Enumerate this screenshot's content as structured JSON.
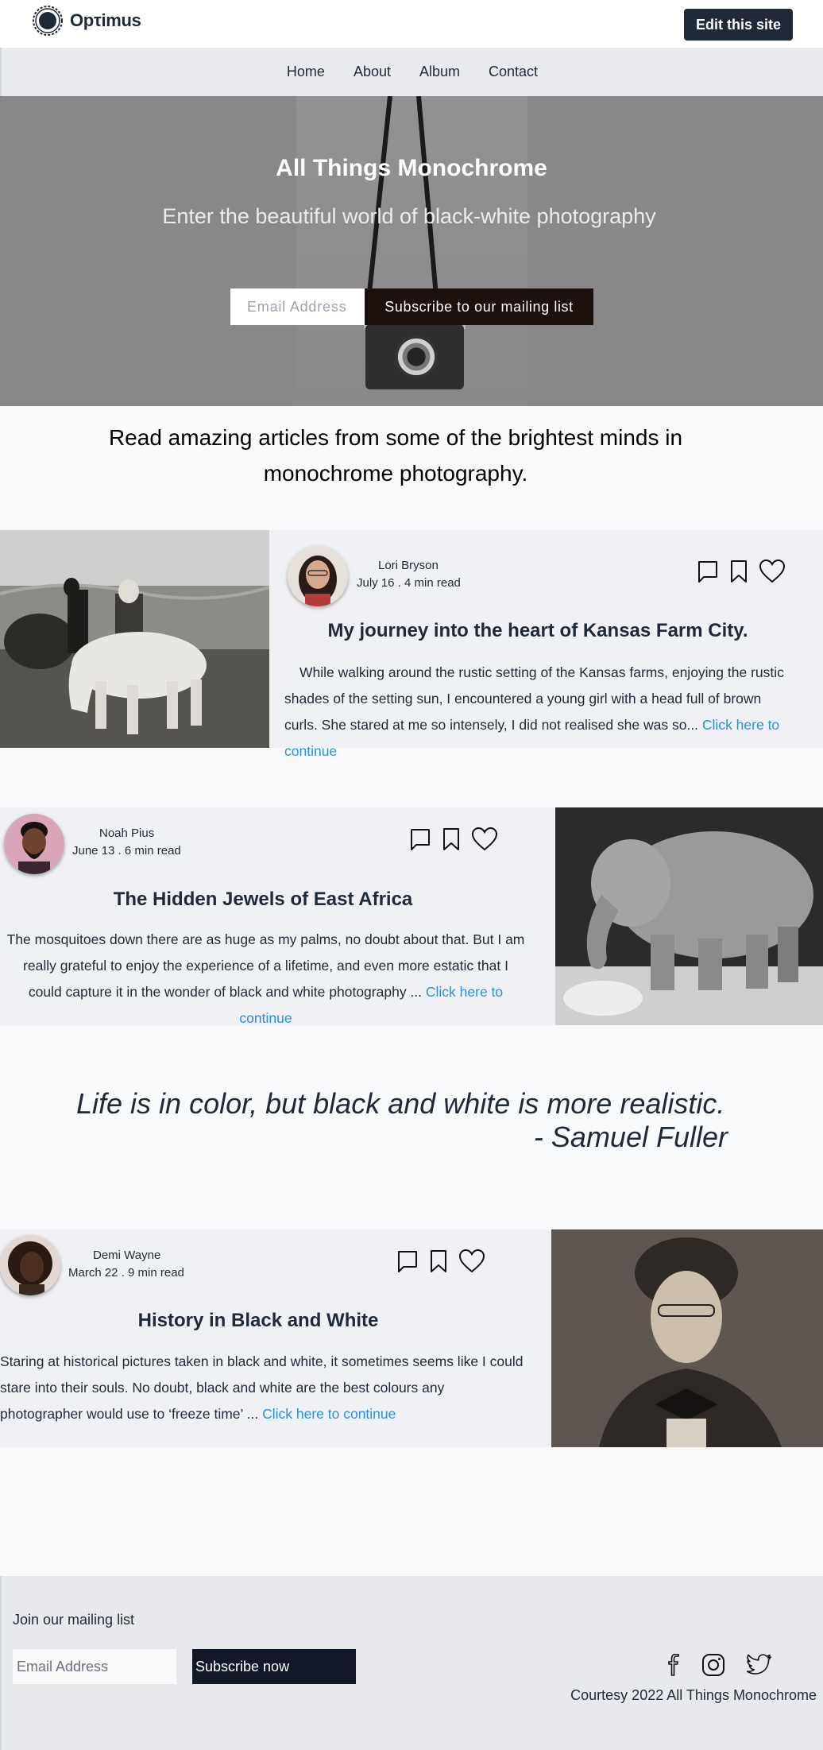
{
  "header": {
    "logo_text": "Opτimus",
    "logo_icon": "sun-gear-icon",
    "edit_button": "Edit this site"
  },
  "nav": {
    "items": [
      {
        "label": "Home"
      },
      {
        "label": "About"
      },
      {
        "label": "Album"
      },
      {
        "label": "Contact"
      }
    ]
  },
  "hero": {
    "title_prefix": "All Things ",
    "title_bold": "Monochrome",
    "subtitle": "Enter the beautiful world of black-white photography",
    "email_placeholder": "Email Address",
    "subscribe_button": "Subscribe to our mailing list"
  },
  "intro": "Read amazing articles from some of the brightest minds in monochrome photography.",
  "articles": [
    {
      "author": "Lori Bryson",
      "meta": "July 16 . 4 min read",
      "title": "My journey into the heart of Kansas Farm City.",
      "excerpt": "While walking around the rustic setting of the Kansas farms, enjoying the rustic shades of the setting sun, I encountered a young girl with a head full of brown curls. She stared at me so intensely, I did not realised she was so... ",
      "link": "Click here to continue"
    },
    {
      "author": "Noah Pius",
      "meta": "June 13 . 6 min read",
      "title": "The Hidden Jewels of East Africa",
      "excerpt": "The mosquitoes down there are as huge as my palms, no doubt about that. But I am really grateful to enjoy the experience of a lifetime, and even more estatic that I could capture it in the wonder of black and white photography ... ",
      "link": "Click here to continue"
    },
    {
      "author": "Demi Wayne",
      "meta": "March 22 . 9 min read",
      "title": "History in Black and White",
      "excerpt": "Staring at historical pictures taken in black and white, it sometimes seems like I could stare into their souls. No doubt, black and white are the best colours any photographer would use to ‘freeze time’ ... ",
      "link": "Click here to continue"
    }
  ],
  "quote": {
    "text": "Life is in color, but black and white is more realistic.",
    "author": "- Samuel Fuller"
  },
  "footer": {
    "label": "Join our mailing list",
    "email_placeholder": "Email Address",
    "subscribe_button": "Subscribe now",
    "social_icons": [
      "facebook-icon",
      "instagram-icon",
      "twitter-icon"
    ],
    "copyright": "Courtesy 2022 All Things Monochrome"
  },
  "colors": {
    "dark": "#1f2937",
    "link": "#2b8fe0",
    "card_bg": "#f0f1f5",
    "hero_button": "#1b100c"
  }
}
